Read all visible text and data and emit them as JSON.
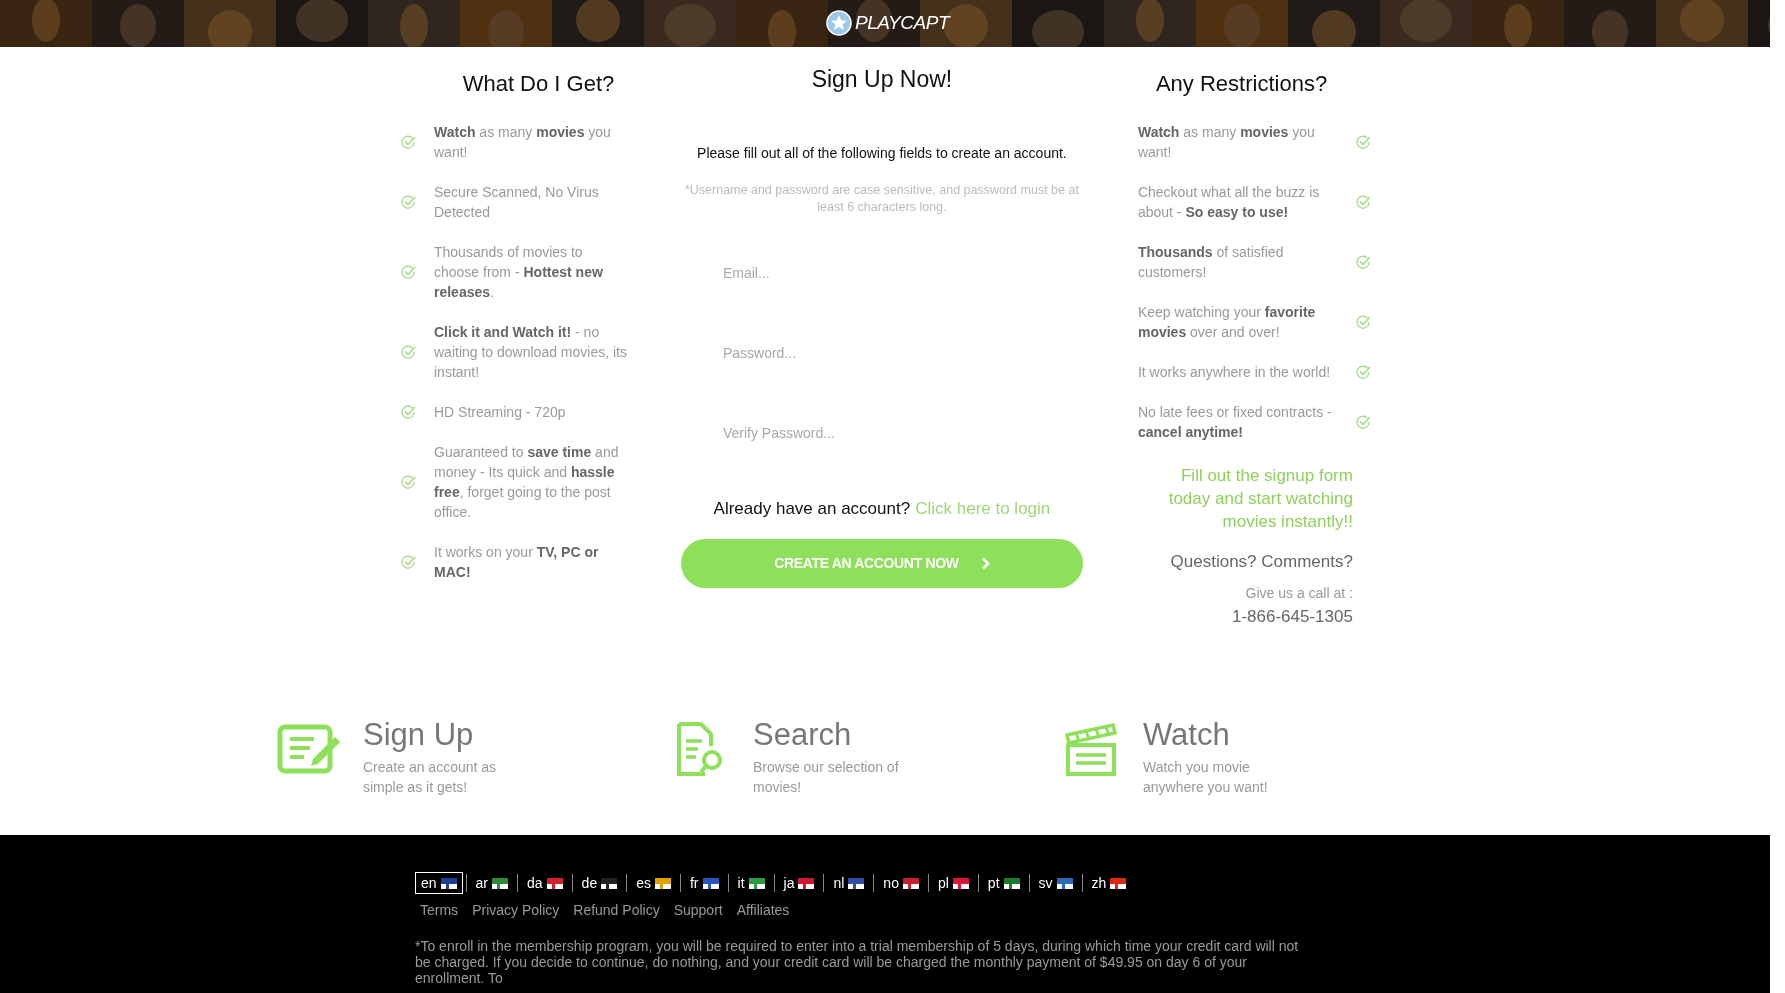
{
  "header": {
    "logo": "PLAYCAPT"
  },
  "benefits": {
    "title": "What Do I Get?",
    "items": [
      "**Watch** as many **movies** you want!",
      "Secure Scanned, No Virus Detected",
      "Thousands of movies to choose from - **Hottest new releases**.",
      "**Click it and Watch it!** - no waiting to download movies, its instant!",
      "HD Streaming - 720p",
      "Guaranteed to **save time** and money - Its quick and **hassle free**, forget going to the post office.",
      "It works on your **TV, PC or MAC!**"
    ]
  },
  "signup": {
    "title": "Sign Up Now!",
    "intro": "Please fill out all of the following fields to create an account.",
    "note": "*Username and password are case sensitive, and password must be at least 6 characters long.",
    "fields": [
      {
        "placeholder": "Email..."
      },
      {
        "placeholder": "Password..."
      },
      {
        "placeholder": "Verify Password..."
      }
    ],
    "login_prompt": "Already have an account?",
    "login_link": "Click here to login",
    "button": "CREATE AN ACCOUNT NOW"
  },
  "restrictions": {
    "title": "Any Restrictions?",
    "items": [
      "**Watch** as many **movies** you want!",
      "Checkout what all the buzz is about - **So easy to use!**",
      "**Thousands** of satisfied customers!",
      "Keep watching your **favorite movies** over and over!",
      "It works anywhere in the world!",
      "No late fees or fixed contracts - **cancel anytime!**"
    ],
    "promo": "Fill out the signup form today and start watching movies instantly!!",
    "contact_heading": "Questions? Comments?",
    "contact_text": "Give us a call at :",
    "phone": "1-866-645-1305"
  },
  "features": [
    {
      "kind": "signup",
      "title": "Sign Up",
      "text": "Create an account as simple as it gets!"
    },
    {
      "kind": "search",
      "title": "Search",
      "text": "Browse our selection of movies!"
    },
    {
      "kind": "watch",
      "title": "Watch",
      "text": "Watch you movie anywhere you want!"
    }
  ],
  "footer": {
    "languages": [
      {
        "code": "en",
        "selected": true,
        "color": "#1f3f8f"
      },
      {
        "code": "ar",
        "selected": false,
        "color": "#2e8b3a"
      },
      {
        "code": "da",
        "selected": false,
        "color": "#d0202e"
      },
      {
        "code": "de",
        "selected": false,
        "color": "#222222"
      },
      {
        "code": "es",
        "selected": false,
        "color": "#e0a000"
      },
      {
        "code": "fr",
        "selected": false,
        "color": "#2a55c0"
      },
      {
        "code": "it",
        "selected": false,
        "color": "#2e9a40"
      },
      {
        "code": "ja",
        "selected": false,
        "color": "#d01830"
      },
      {
        "code": "nl",
        "selected": false,
        "color": "#2e4ea8"
      },
      {
        "code": "no",
        "selected": false,
        "color": "#c8202e"
      },
      {
        "code": "pl",
        "selected": false,
        "color": "#dc143c"
      },
      {
        "code": "pt",
        "selected": false,
        "color": "#1a7a30"
      },
      {
        "code": "sv",
        "selected": false,
        "color": "#2a6ab8"
      },
      {
        "code": "zh",
        "selected": false,
        "color": "#de2910"
      }
    ],
    "links": [
      "Terms",
      "Privacy Policy",
      "Refund Policy",
      "Support",
      "Affiliates"
    ],
    "disclaimer": "*To enroll in the membership program, you will be required to enter into a trial membership of 5 days, during which time your credit card will not be charged. If you decide to continue, do nothing, and your credit card will be charged the monthly payment of $49.95 on day 6 of your enrollment. To"
  }
}
